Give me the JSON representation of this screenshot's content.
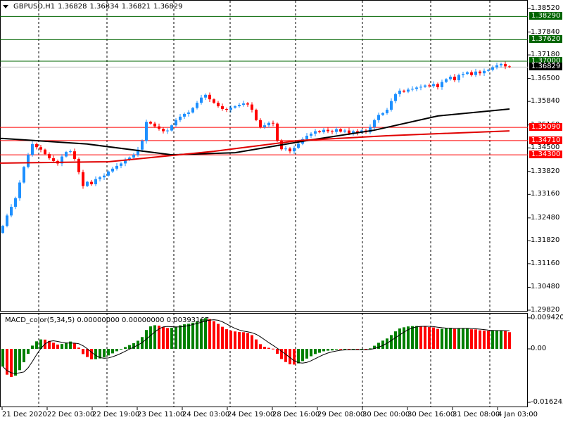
{
  "header": {
    "symbol": "GBPUSD,H1",
    "open": "1.36828",
    "high": "1.36834",
    "low": "1.36821",
    "close": "1.36829"
  },
  "macd_header": {
    "name": "MACD_color(5,34,5)",
    "v1": "0.00000000",
    "v2": "0.00000000",
    "v3": "0.00393167"
  },
  "price_axis": [
    "1.38520",
    "1.37840",
    "1.37180",
    "1.36500",
    "1.35840",
    "1.35160",
    "1.34500",
    "1.33820",
    "1.33160",
    "1.32480",
    "1.31820",
    "1.31160",
    "1.30480",
    "1.29820"
  ],
  "macd_axis": {
    "top": "0.0094204",
    "zero": "0.00",
    "bottom": "-0.016243"
  },
  "time_axis": [
    "21 Dec 2020",
    "22 Dec 03:00",
    "22 Dec 19:00",
    "23 Dec 11:00",
    "24 Dec 03:00",
    "24 Dec 19:00",
    "28 Dec 16:00",
    "29 Dec 08:00",
    "30 Dec 00:00",
    "30 Dec 16:00",
    "31 Dec 08:00",
    "4 Jan 03:00"
  ],
  "levels": [
    {
      "price": "1.38290",
      "color": "#006400"
    },
    {
      "price": "1.37620",
      "color": "#006400"
    },
    {
      "price": "1.37000",
      "color": "#006400"
    },
    {
      "price": "1.35090",
      "color": "#ff0000"
    },
    {
      "price": "1.34710",
      "color": "#ff0000"
    },
    {
      "price": "1.34300",
      "color": "#ff0000"
    }
  ],
  "current_price": "1.36829",
  "colors": {
    "bull": "#1e90ff",
    "bear": "#ff0000",
    "macd_up": "#008000",
    "macd_down": "#ff0000",
    "ma_slow": "#000000",
    "ma_fast": "#e00000"
  },
  "chart_data": {
    "type": "candlestick",
    "symbol": "GBPUSD",
    "timeframe": "H1",
    "ylim": [
      1.2982,
      1.3852
    ],
    "closes": [
      1.3225,
      1.3255,
      1.328,
      1.3305,
      1.335,
      1.3395,
      1.343,
      1.3461,
      1.3452,
      1.3445,
      1.3432,
      1.342,
      1.3412,
      1.3405,
      1.3425,
      1.3438,
      1.344,
      1.3418,
      1.338,
      1.334,
      1.3352,
      1.3345,
      1.336,
      1.3365,
      1.337,
      1.3382,
      1.339,
      1.3398,
      1.3405,
      1.3415,
      1.3422,
      1.343,
      1.3445,
      1.347,
      1.3525,
      1.352,
      1.3512,
      1.3505,
      1.3498,
      1.35,
      1.3515,
      1.353,
      1.354,
      1.3548,
      1.3552,
      1.3565,
      1.358,
      1.3595,
      1.3603,
      1.359,
      1.358,
      1.357,
      1.3562,
      1.356,
      1.3566,
      1.357,
      1.3574,
      1.3578,
      1.3575,
      1.356,
      1.353,
      1.351,
      1.3515,
      1.3522,
      1.352,
      1.347,
      1.3446,
      1.3448,
      1.344,
      1.345,
      1.3462,
      1.3475,
      1.3485,
      1.3491,
      1.3498,
      1.3495,
      1.3502,
      1.3498,
      1.3496,
      1.3504,
      1.3497,
      1.35,
      1.3492,
      1.3498,
      1.3494,
      1.35,
      1.3495,
      1.351,
      1.353,
      1.3545,
      1.355,
      1.356,
      1.3585,
      1.3605,
      1.3615,
      1.3612,
      1.3618,
      1.362,
      1.3624,
      1.3626,
      1.363,
      1.3628,
      1.3634,
      1.3625,
      1.364,
      1.3648,
      1.3655,
      1.3645,
      1.366,
      1.3663,
      1.3668,
      1.366,
      1.367,
      1.3665,
      1.3672,
      1.3675,
      1.3682,
      1.3688,
      1.3692,
      1.3685,
      1.3683
    ],
    "ma_slow": [
      [
        0,
        1.3477
      ],
      [
        20,
        1.3461
      ],
      [
        40,
        1.343
      ],
      [
        55,
        1.3436
      ],
      [
        72,
        1.3471
      ],
      [
        88,
        1.3501
      ],
      [
        103,
        1.3542
      ],
      [
        120,
        1.3562
      ]
    ],
    "ma_fast": [
      [
        0,
        1.3406
      ],
      [
        25,
        1.341
      ],
      [
        50,
        1.344
      ],
      [
        70,
        1.3471
      ],
      [
        91,
        1.3485
      ],
      [
        120,
        1.3499
      ]
    ],
    "macd_ylim": [
      -0.016243,
      0.0094204
    ]
  }
}
